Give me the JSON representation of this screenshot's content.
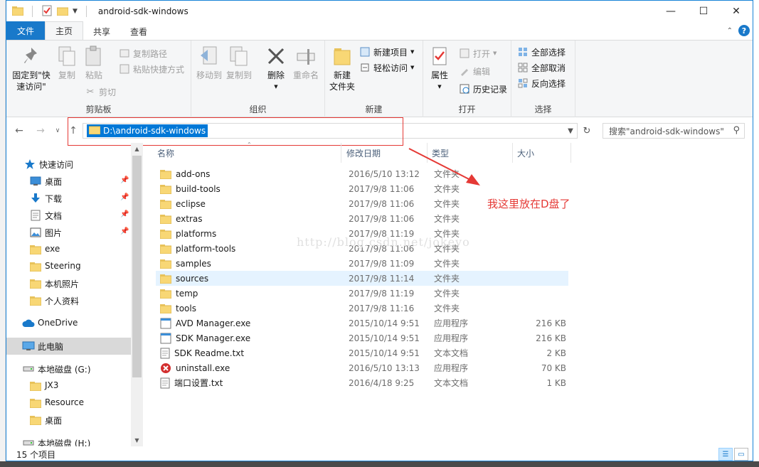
{
  "window": {
    "title": "android-sdk-windows"
  },
  "ribbon": {
    "tabs": [
      "文件",
      "主页",
      "共享",
      "查看"
    ],
    "clipboard": {
      "label": "剪贴板",
      "pin_quick": "固定到\"快\n速访问\"",
      "copy": "复制",
      "paste": "粘贴",
      "copy_path": "复制路径",
      "paste_shortcut": "粘贴快捷方式",
      "cut": "剪切"
    },
    "organize": {
      "label": "组织",
      "move_to": "移动到",
      "copy_to": "复制到",
      "delete": "删除",
      "rename": "重命名"
    },
    "new": {
      "label": "新建",
      "new_folder": "新建\n文件夹",
      "new_item": "新建项目",
      "easy_access": "轻松访问"
    },
    "open": {
      "label": "打开",
      "properties": "属性",
      "open": "打开",
      "edit": "编辑",
      "history": "历史记录"
    },
    "select": {
      "label": "选择",
      "select_all": "全部选择",
      "select_none": "全部取消",
      "invert": "反向选择"
    }
  },
  "address": {
    "path": "D:\\android-sdk-windows",
    "search_placeholder": "搜索\"android-sdk-windows\""
  },
  "nav": {
    "items": [
      {
        "label": "快速访问",
        "icon": "star-icon"
      },
      {
        "label": "桌面",
        "icon": "desktop-icon",
        "pinned": true
      },
      {
        "label": "下载",
        "icon": "download-icon",
        "pinned": true
      },
      {
        "label": "文档",
        "icon": "document-icon",
        "pinned": true
      },
      {
        "label": "图片",
        "icon": "picture-icon",
        "pinned": true
      },
      {
        "label": "exe",
        "icon": "folder-icon"
      },
      {
        "label": "Steering",
        "icon": "folder-icon"
      },
      {
        "label": "本机照片",
        "icon": "folder-icon"
      },
      {
        "label": "个人资料",
        "icon": "folder-icon"
      },
      {
        "label": "OneDrive",
        "icon": "cloud-icon"
      },
      {
        "label": "此电脑",
        "icon": "computer-icon"
      },
      {
        "label": "本地磁盘 (G:)",
        "icon": "drive-icon"
      },
      {
        "label": "JX3",
        "icon": "folder-icon"
      },
      {
        "label": "Resource",
        "icon": "folder-icon"
      },
      {
        "label": "桌面",
        "icon": "folder-icon"
      },
      {
        "label": "本地磁盘 (H:)",
        "icon": "drive-icon"
      }
    ]
  },
  "columns": {
    "name": "名称",
    "date": "修改日期",
    "type": "类型",
    "size": "大小"
  },
  "files": [
    {
      "name": "add-ons",
      "date": "2016/5/10 13:12",
      "type": "文件夹",
      "size": "",
      "icon": "folder-icon"
    },
    {
      "name": "build-tools",
      "date": "2017/9/8 11:06",
      "type": "文件夹",
      "size": "",
      "icon": "folder-icon"
    },
    {
      "name": "eclipse",
      "date": "2017/9/8 11:06",
      "type": "文件夹",
      "size": "",
      "icon": "folder-icon"
    },
    {
      "name": "extras",
      "date": "2017/9/8 11:06",
      "type": "文件夹",
      "size": "",
      "icon": "folder-icon"
    },
    {
      "name": "platforms",
      "date": "2017/9/8 11:19",
      "type": "文件夹",
      "size": "",
      "icon": "folder-icon"
    },
    {
      "name": "platform-tools",
      "date": "2017/9/8 11:06",
      "type": "文件夹",
      "size": "",
      "icon": "folder-icon"
    },
    {
      "name": "samples",
      "date": "2017/9/8 11:09",
      "type": "文件夹",
      "size": "",
      "icon": "folder-icon"
    },
    {
      "name": "sources",
      "date": "2017/9/8 11:14",
      "type": "文件夹",
      "size": "",
      "icon": "folder-icon",
      "hover": true
    },
    {
      "name": "temp",
      "date": "2017/9/8 11:19",
      "type": "文件夹",
      "size": "",
      "icon": "folder-icon"
    },
    {
      "name": "tools",
      "date": "2017/9/8 11:16",
      "type": "文件夹",
      "size": "",
      "icon": "folder-icon"
    },
    {
      "name": "AVD Manager.exe",
      "date": "2015/10/14 9:51",
      "type": "应用程序",
      "size": "216 KB",
      "icon": "app-icon"
    },
    {
      "name": "SDK Manager.exe",
      "date": "2015/10/14 9:51",
      "type": "应用程序",
      "size": "216 KB",
      "icon": "app-icon"
    },
    {
      "name": "SDK Readme.txt",
      "date": "2015/10/14 9:51",
      "type": "文本文档",
      "size": "2 KB",
      "icon": "text-file-icon"
    },
    {
      "name": "uninstall.exe",
      "date": "2016/5/10 13:13",
      "type": "应用程序",
      "size": "70 KB",
      "icon": "uninstall-icon"
    },
    {
      "name": "端口设置.txt",
      "date": "2016/4/18 9:25",
      "type": "文本文档",
      "size": "1 KB",
      "icon": "text-file-icon"
    }
  ],
  "watermark": "http://blog.csdn.net/jokeyo",
  "annotation": "我这里放在D盘了",
  "status": {
    "count": "15 个项目"
  },
  "colors": {
    "accent": "#1979ca",
    "selection": "#0078d7",
    "annotation": "#e53935"
  }
}
